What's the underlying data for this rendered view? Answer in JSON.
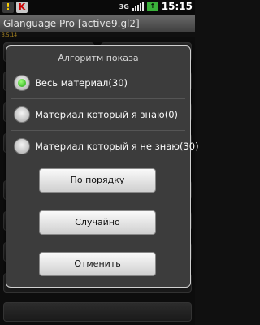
{
  "status_bar": {
    "time": "15:15",
    "network": "3G",
    "battery_label": "",
    "left_icons": [
      "warning-icon",
      "k-app-icon"
    ]
  },
  "app": {
    "title": "Glanguage Pro [active9.gl2]",
    "version": "3.5.14"
  },
  "dialog": {
    "title": "Алгоритм показа",
    "options": [
      {
        "label": "Весь материал(30)",
        "selected": true
      },
      {
        "label": "Материал который я знаю(0)",
        "selected": false
      },
      {
        "label": "Материал который я не знаю(30)",
        "selected": false
      }
    ],
    "buttons": {
      "in_order": "По порядку",
      "random": "Случайно",
      "cancel": "Отменить"
    }
  },
  "colors": {
    "dialog_bg": "#3c3c3c",
    "radio_selected": "#1ba10e",
    "version_text": "#b08a20"
  }
}
